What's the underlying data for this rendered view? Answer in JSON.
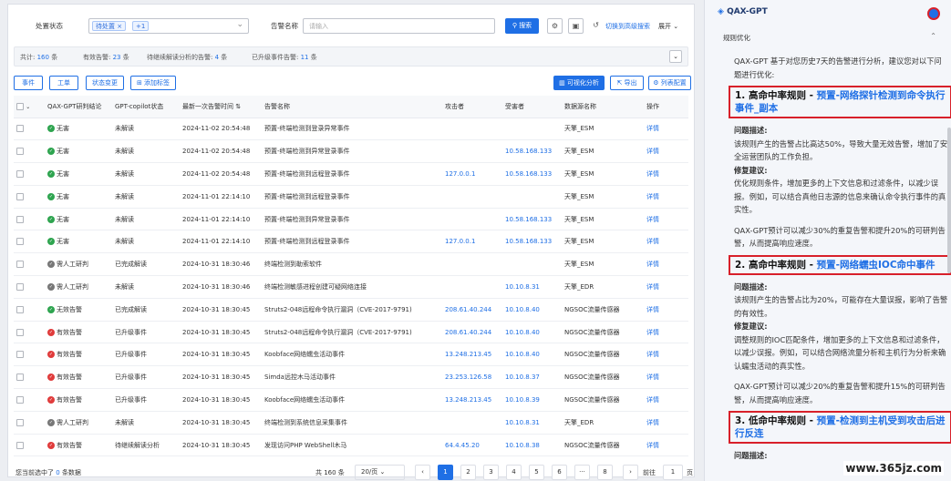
{
  "filter": {
    "status_label": "处置状态",
    "status_tag": "待处置",
    "status_more": "+1",
    "name_label": "告警名称",
    "name_placeholder": "请输入",
    "search": "搜索",
    "advanced": "切换到高级搜索",
    "expand": "展开"
  },
  "stats": {
    "total_label": "共计:",
    "total": "160",
    "total_unit": "条",
    "valid_label": "有效告警:",
    "valid": "23",
    "valid_unit": "条",
    "pending_label": "待继续解读分析的告警:",
    "pending": "4",
    "pending_unit": "条",
    "upgraded_label": "已升级事件告警:",
    "upgraded": "11",
    "upgraded_unit": "条"
  },
  "actions": {
    "event": "事件",
    "ticket": "工单",
    "change_status": "状态变更",
    "add_tag": "添加标签",
    "visual": "可视化分析",
    "export": "导出",
    "list_config": "列表配置"
  },
  "columns": [
    "",
    "QAX-GPT研判结论",
    "GPT-copilot状态",
    "最新一次告警时间",
    "告警名称",
    "攻击者",
    "受害者",
    "数据源名称",
    "操作"
  ],
  "rows": [
    {
      "verdict": "无害",
      "vc": "#2ea44f",
      "status": "未解读",
      "time": "2024-11-02 20:54:48",
      "name": "预置-终端检测到登录异常事件",
      "attacker": "",
      "victim": "",
      "source": "天擎_ESM",
      "op": "详情"
    },
    {
      "verdict": "无害",
      "vc": "#2ea44f",
      "status": "未解读",
      "time": "2024-11-02 20:54:48",
      "name": "预置-终端检测到异常登录事件",
      "attacker": "",
      "victim": "10.58.168.133",
      "source": "天擎_ESM",
      "op": "详情"
    },
    {
      "verdict": "无害",
      "vc": "#2ea44f",
      "status": "未解读",
      "time": "2024-11-02 20:54:48",
      "name": "预置-终端检测到远程登录事件",
      "attacker": "127.0.0.1",
      "victim": "10.58.168.133",
      "source": "天擎_ESM",
      "op": "详情"
    },
    {
      "verdict": "无害",
      "vc": "#2ea44f",
      "status": "未解读",
      "time": "2024-11-01 22:14:10",
      "name": "预置-终端检测到远程登录事件",
      "attacker": "",
      "victim": "",
      "source": "天擎_ESM",
      "op": "详情"
    },
    {
      "verdict": "无害",
      "vc": "#2ea44f",
      "status": "未解读",
      "time": "2024-11-01 22:14:10",
      "name": "预置-终端检测到异常登录事件",
      "attacker": "",
      "victim": "10.58.168.133",
      "source": "天擎_ESM",
      "op": "详情"
    },
    {
      "verdict": "无害",
      "vc": "#2ea44f",
      "status": "未解读",
      "time": "2024-11-01 22:14:10",
      "name": "预置-终端检测到远程登录事件",
      "attacker": "127.0.0.1",
      "victim": "10.58.168.133",
      "source": "天擎_ESM",
      "op": "详情"
    },
    {
      "verdict": "需人工研判",
      "vc": "#777",
      "status": "已完成解读",
      "time": "2024-10-31 18:30:46",
      "name": "终端检测到勒索软件",
      "attacker": "",
      "victim": "",
      "source": "天擎_ESM",
      "op": "详情"
    },
    {
      "verdict": "需人工研判",
      "vc": "#777",
      "status": "未解读",
      "time": "2024-10-31 18:30:46",
      "name": "终端检测敏感进程创建可疑网络连接",
      "attacker": "",
      "victim": "10.10.8.31",
      "source": "天擎_EDR",
      "op": "详情"
    },
    {
      "verdict": "无效告警",
      "vc": "#2ea44f",
      "status": "已完成解读",
      "time": "2024-10-31 18:30:45",
      "name": "Struts2-048远程命令执行漏洞（CVE-2017-9791)",
      "attacker": "208.61.40.244",
      "victim": "10.10.8.40",
      "source": "NGSOC流量传感器",
      "op": "详情"
    },
    {
      "verdict": "有效告警",
      "vc": "#e03b3b",
      "status": "已升级事件",
      "time": "2024-10-31 18:30:45",
      "name": "Struts2-048远程命令执行漏洞（CVE-2017-9791)",
      "attacker": "208.61.40.244",
      "victim": "10.10.8.40",
      "source": "NGSOC流量传感器",
      "op": "详情"
    },
    {
      "verdict": "有效告警",
      "vc": "#e03b3b",
      "status": "已升级事件",
      "time": "2024-10-31 18:30:45",
      "name": "Koobface网络蠕虫活动事件",
      "attacker": "13.248.213.45",
      "victim": "10.10.8.40",
      "source": "NGSOC流量传感器",
      "op": "详情"
    },
    {
      "verdict": "有效告警",
      "vc": "#e03b3b",
      "status": "已升级事件",
      "time": "2024-10-31 18:30:45",
      "name": "Simda远控木马活动事件",
      "attacker": "23.253.126.58",
      "victim": "10.10.8.37",
      "source": "NGSOC流量传感器",
      "op": "详情"
    },
    {
      "verdict": "有效告警",
      "vc": "#e03b3b",
      "status": "已升级事件",
      "time": "2024-10-31 18:30:45",
      "name": "Koobface网络蠕虫活动事件",
      "attacker": "13.248.213.45",
      "victim": "10.10.8.39",
      "source": "NGSOC流量传感器",
      "op": "详情"
    },
    {
      "verdict": "需人工研判",
      "vc": "#777",
      "status": "未解读",
      "time": "2024-10-31 18:30:45",
      "name": "终端检测到系统信息采集事件",
      "attacker": "",
      "victim": "10.10.8.31",
      "source": "天擎_EDR",
      "op": "详情"
    },
    {
      "verdict": "有效告警",
      "vc": "#e03b3b",
      "status": "待继续解读分析",
      "time": "2024-10-31 18:30:45",
      "name": "发现访问PHP WebShell木马",
      "attacker": "64.4.45.20",
      "victim": "10.10.8.38",
      "source": "NGSOC流量传感器",
      "op": "详情"
    }
  ],
  "pager": {
    "selected_prefix": "您当前选中了",
    "selected": "0",
    "selected_suffix": "条数据",
    "total": "共 160 条",
    "size": "20/页",
    "pages": [
      "1",
      "2",
      "3",
      "4",
      "5",
      "6",
      "···",
      "8"
    ],
    "goto": "前往",
    "goto_val": "1",
    "goto_unit": "页"
  },
  "ai": {
    "title": "QAX-GPT",
    "section": "规则优化",
    "intro": "QAX-GPT 基于对您历史7天的告警进行分析，建议您对以下问题进行优化:",
    "r1_title": "1. 高命中率规则 - ",
    "r1_name": "预置-网络探针检测到命令执行事件_副本",
    "r1_desc_h": "问题描述:",
    "r1_desc": "该规则产生的告警占比高达50%，导致大量无效告警，增加了安全运营团队的工作负担。",
    "r1_fix_h": "修复建议:",
    "r1_fix": "优化规则条件，增加更多的上下文信息和过滤条件，以减少误报。例如，可以结合真他日志源的信息来确认命令执行事件的真实性。",
    "r1_eff": "QAX-GPT预计可以减少30%的重复告警和提升20%的可研判告警，从而提高响应速度。",
    "r2_title": "2. 高命中率规则 - ",
    "r2_name": "预置-网络蠕虫IOC命中事件",
    "r2_desc_h": "问题描述:",
    "r2_desc": "该规则产生的告警占比为20%，可能存在大量误报，影响了告警的有效性。",
    "r2_fix_h": "修复建议:",
    "r2_fix": "调整规则的IOC匹配条件，增加更多的上下文信息和过滤条件，以减少误报。例如，可以结合网络流量分析和主机行为分析来确认蠕虫活动的真实性。",
    "r2_eff": "QAX-GPT预计可以减少20%的重复告警和提升15%的可研判告警，从而提高响应速度。",
    "r3_title": "3. 低命中率规则 - ",
    "r3_name": "预置-检测到主机受到攻击后进行反连",
    "r3_desc_h": "问题描述:"
  },
  "watermark": "www.365jz.com"
}
